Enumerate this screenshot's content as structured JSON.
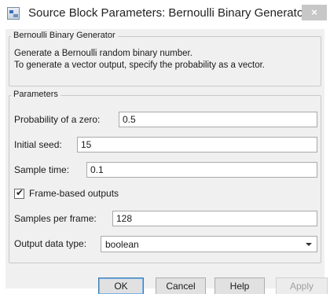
{
  "window": {
    "title": "Source Block Parameters: Bernoulli Binary Generator",
    "close_glyph": "×"
  },
  "description": {
    "group_title": "Bernoulli Binary Generator",
    "line1": "Generate a Bernoulli random binary number.",
    "line2": "To generate a vector output, specify the probability as a vector."
  },
  "parameters": {
    "group_title": "Parameters",
    "probability_zero": {
      "label": "Probability of a zero:",
      "value": "0.5"
    },
    "initial_seed": {
      "label": "Initial seed:",
      "value": "15"
    },
    "sample_time": {
      "label": "Sample time:",
      "value": "0.1"
    },
    "frame_based": {
      "label": "Frame-based outputs",
      "checked": true
    },
    "samples_per_frame": {
      "label": "Samples per frame:",
      "value": "128"
    },
    "output_data_type": {
      "label": "Output data type:",
      "selected": "boolean"
    }
  },
  "buttons": {
    "ok": "OK",
    "cancel": "Cancel",
    "help": "Help",
    "apply": "Apply"
  }
}
